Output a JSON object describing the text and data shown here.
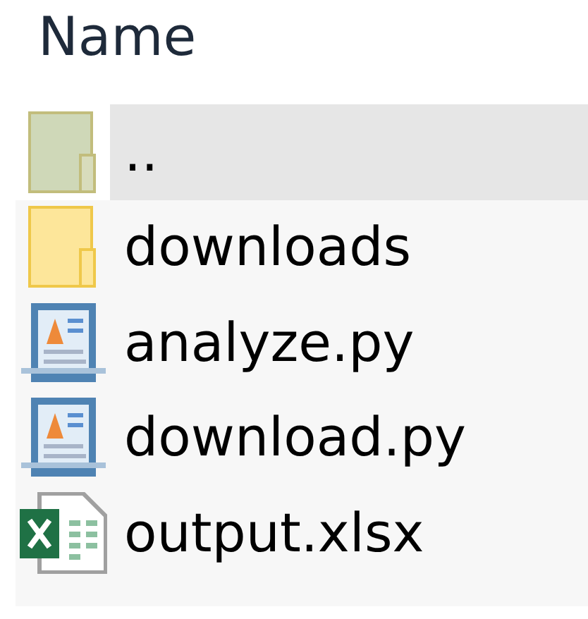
{
  "header": {
    "column_1": "Name"
  },
  "files": [
    {
      "name": "..",
      "kind": "parent",
      "selected": true
    },
    {
      "name": "downloads",
      "kind": "folder",
      "selected": false
    },
    {
      "name": "analyze.py",
      "kind": "script",
      "selected": false
    },
    {
      "name": "download.py",
      "kind": "script",
      "selected": false
    },
    {
      "name": "output.xlsx",
      "kind": "spreadsheet",
      "selected": false
    }
  ]
}
